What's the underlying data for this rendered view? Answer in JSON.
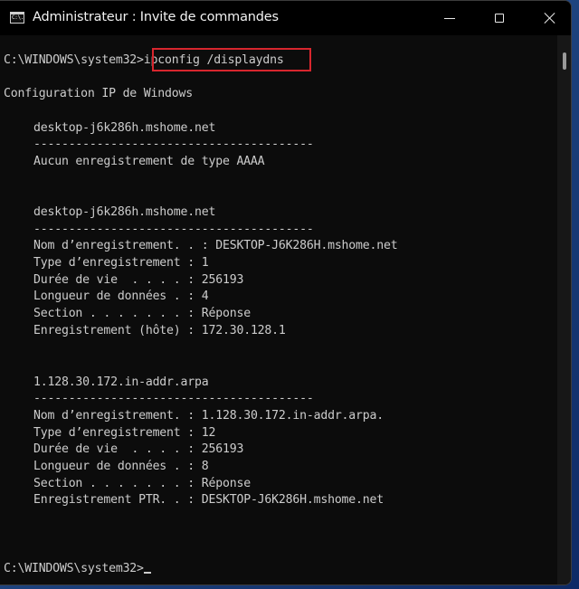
{
  "window": {
    "title": "Administrateur : Invite de commandes",
    "app_icon_text": "C:\\.",
    "controls": [
      "minimize",
      "maximize",
      "close"
    ]
  },
  "console": {
    "prompt_command": {
      "prompt": "C:\\WINDOWS\\system32>",
      "command": "ipconfig /displaydns"
    },
    "header": "Configuration IP de Windows",
    "separator": "----------------------------------------",
    "sections": [
      {
        "name": "desktop-j6k286h.mshome.net",
        "message": "Aucun enregistrement de type AAAA"
      },
      {
        "name": "desktop-j6k286h.mshome.net",
        "fields": [
          {
            "label": "Nom d’enregistrement. . :",
            "value": "DESKTOP-J6K286H.mshome.net"
          },
          {
            "label": "Type d’enregistrement :",
            "value": "1"
          },
          {
            "label": "Durée de vie  . . . . :",
            "value": "256193"
          },
          {
            "label": "Longueur de données . :",
            "value": "4"
          },
          {
            "label": "Section . . . . . . . :",
            "value": "Réponse"
          },
          {
            "label": "Enregistrement (hôte) :",
            "value": "172.30.128.1"
          }
        ]
      },
      {
        "name": "1.128.30.172.in-addr.arpa",
        "fields": [
          {
            "label": "Nom d’enregistrement. :",
            "value": "1.128.30.172.in-addr.arpa."
          },
          {
            "label": "Type d’enregistrement :",
            "value": "12"
          },
          {
            "label": "Durée de vie  . . . . :",
            "value": "256193"
          },
          {
            "label": "Longueur de données . :",
            "value": "8"
          },
          {
            "label": "Section . . . . . . . :",
            "value": "Réponse"
          },
          {
            "label": "Enregistrement PTR. . :",
            "value": "DESKTOP-J6K286H.mshome.net"
          }
        ]
      }
    ],
    "final_prompt": "C:\\WINDOWS\\system32>"
  },
  "colors": {
    "console_bg": "#0c0c0c",
    "console_text": "#cccccc",
    "highlight_border": "#d8262e"
  }
}
